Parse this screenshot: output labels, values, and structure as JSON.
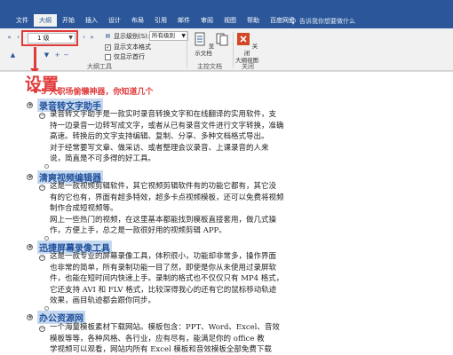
{
  "tabs": [
    {
      "label": "文件",
      "active": false
    },
    {
      "label": "大纲",
      "active": true
    },
    {
      "label": "开始",
      "active": false
    },
    {
      "label": "插入",
      "active": false
    },
    {
      "label": "设计",
      "active": false
    },
    {
      "label": "布局",
      "active": false
    },
    {
      "label": "引用",
      "active": false
    },
    {
      "label": "邮件",
      "active": false
    },
    {
      "label": "审阅",
      "active": false
    },
    {
      "label": "视图",
      "active": false
    },
    {
      "label": "帮助",
      "active": false
    },
    {
      "label": "百度网盘",
      "active": false
    }
  ],
  "tellme": "告诉我你想要做什么",
  "ribbon": {
    "level_value": "1 级",
    "show_level_label": "显示级别(S):",
    "show_level_value": "所有级别",
    "show_text_format": "显示文本格式",
    "show_first_line": "仅显示首行",
    "outline_tools_label": "大纲工具",
    "show_document": "显示文档",
    "master_doc_label": "主控文档",
    "close_outline_line1": "关闭",
    "close_outline_line2": "大纲视图",
    "close_label": "关闭"
  },
  "colors": {
    "accent": "#2b579a",
    "annotation": "#e03b3b",
    "heading": "#1e4f9c",
    "highlight": "#c7d9ef"
  },
  "annotation_text": "设置",
  "document": {
    "title": "5 大职场偷懒神器，你知道几个",
    "sections": [
      {
        "heading": "录音转文字助手",
        "lines": [
          "录音转文字助手是一款实时录音转换文字和在线翻译的实用软件，支",
          "持一边录音一边转写成文字，或者从已有录音文件进行文字转换，准确",
          "高速。转换后的文字支持编辑、复制、分享、多种文档格式导出。",
          "对于经常要写文章、做采访、或者整理会议录音、上课录音的人来",
          "说，简直是不可多得的好工具。"
        ]
      },
      {
        "heading": "清爽视频编辑器",
        "lines": [
          "这是一款视频剪辑软件，其它视频剪辑软件有的功能它都有，其它没",
          "有的它也有，界面有超多特效，超多卡点视频模板，还可以免费将视频",
          "制作合成短视频等。",
          "网上一些热门的视频，在这里基本都能找到模板直接套用，做几式操",
          "作，方便上手，总之是一款很好用的视频剪辑 APP。"
        ]
      },
      {
        "heading": "迅捷屏幕录像工具",
        "lines": [
          "这是一款专业的屏幕录像工具，体积很小，功能却非常多，操作界面",
          "也非常的简单，所有录制功能一目了然，即使是你从未使用过录屏软",
          "件，也能在短时间内快速上手。录制的格式也不仅仅只有 MP4 格式，",
          "它还支持 AVI 和 FLV 格式，比较深得我心的还有它的鼠标移动轨迹",
          "效果，画目轨迹都会跟你同步。"
        ]
      },
      {
        "heading": "办公资源网",
        "lines": [
          "一个海量模板素材下载网站。模板包含：PPT、Word、Excel、音效",
          "模板等等，各种风格、各行业，应有尽有，能满足你的 office 教",
          "学视频可以观看，网站内所有 Excel 模板和音效模板全部免费下载"
        ]
      }
    ]
  }
}
